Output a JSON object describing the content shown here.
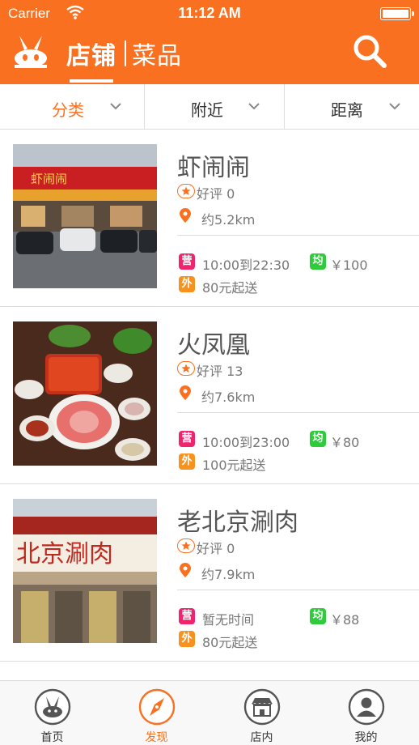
{
  "status_bar": {
    "carrier": "Carrier",
    "time": "11:12 AM"
  },
  "header": {
    "tabs": [
      {
        "label": "店铺",
        "active": true
      },
      {
        "label": "菜品",
        "active": false
      }
    ],
    "search_icon": "search-icon",
    "logo_icon": "rabbit-logo-icon"
  },
  "filters": [
    {
      "label": "分类",
      "active": true
    },
    {
      "label": "附近",
      "active": false
    },
    {
      "label": "距离",
      "active": false
    }
  ],
  "shops": [
    {
      "name": "虾闹闹",
      "rating": "好评 0",
      "distance": "约5.2km",
      "hours_tag": "营",
      "hours": "10:00到22:30",
      "avg_tag": "均",
      "avg_price": "￥100",
      "delivery_tag": "外",
      "delivery": "80元起送"
    },
    {
      "name": "火凤凰",
      "rating": "好评 13",
      "distance": "约7.6km",
      "hours_tag": "营",
      "hours": "10:00到23:00",
      "avg_tag": "均",
      "avg_price": "￥80",
      "delivery_tag": "外",
      "delivery": "100元起送"
    },
    {
      "name": "老北京涮肉",
      "rating": "好评 0",
      "distance": "约7.9km",
      "hours_tag": "营",
      "hours": "暂无时间",
      "avg_tag": "均",
      "avg_price": "￥88",
      "delivery_tag": "外",
      "delivery": "80元起送"
    }
  ],
  "bottom_nav": [
    {
      "label": "首页",
      "icon": "home-rabbit-icon",
      "active": false
    },
    {
      "label": "发现",
      "icon": "compass-icon",
      "active": true
    },
    {
      "label": "店内",
      "icon": "store-icon",
      "active": false
    },
    {
      "label": "我的",
      "icon": "user-icon",
      "active": false
    }
  ],
  "colors": {
    "accent": "#f97120",
    "tag_red": "#f0246e",
    "tag_orange": "#f7921e",
    "tag_green": "#2ecb3a"
  },
  "photo_signs": [
    "虾闹闹",
    "北京涮肉"
  ]
}
